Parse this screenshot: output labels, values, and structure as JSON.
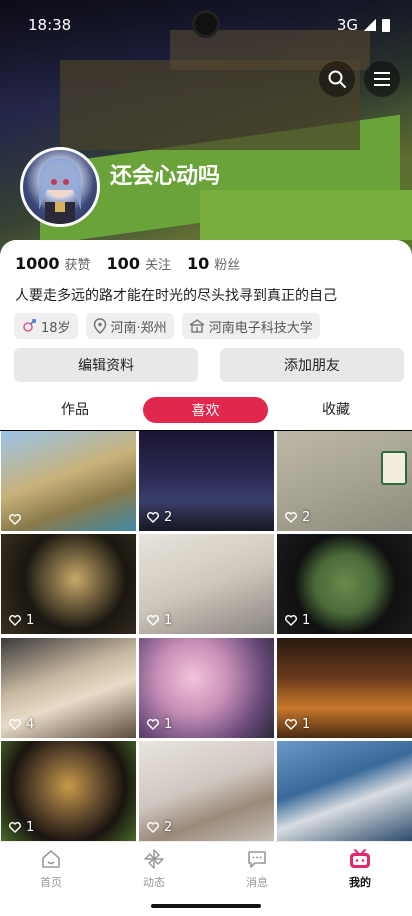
{
  "status": {
    "time": "18:38",
    "network": "3G"
  },
  "profile": {
    "username": "还会心动吗",
    "subtag": "",
    "stats": [
      {
        "num": "1000",
        "label": "获赞"
      },
      {
        "num": "100",
        "label": "关注"
      },
      {
        "num": "10",
        "label": "粉丝"
      }
    ],
    "bio": "人要走多远的路才能在时光的尽头找寻到真正的自己",
    "chips": {
      "age": "18岁",
      "location": "河南·郑州",
      "school": "河南电子科技大学"
    }
  },
  "actions": {
    "edit": "编辑资料",
    "add_friend": "添加朋友"
  },
  "tabs": {
    "works": "作品",
    "likes": "喜欢",
    "favorites": "收藏"
  },
  "grid": [
    {
      "likes": ""
    },
    {
      "likes": "2"
    },
    {
      "likes": "2"
    },
    {
      "likes": "1"
    },
    {
      "likes": "1"
    },
    {
      "likes": "1"
    },
    {
      "likes": "4"
    },
    {
      "likes": "1"
    },
    {
      "likes": "1"
    },
    {
      "likes": "1"
    },
    {
      "likes": "2"
    },
    {
      "likes": ""
    }
  ],
  "nav": {
    "home": "首页",
    "dynamic": "动态",
    "messages": "消息",
    "mine": "我的"
  },
  "colors": {
    "accent": "#e0284d",
    "mine_active": "#e0286e"
  }
}
